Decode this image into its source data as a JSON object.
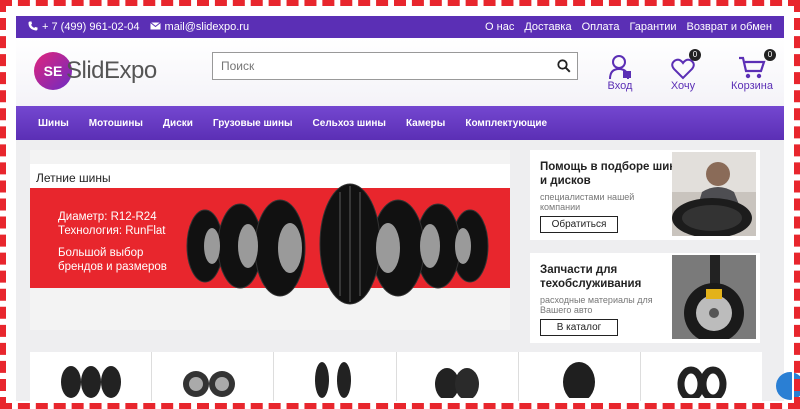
{
  "topbar": {
    "phone": "+ 7 (499) 961-02-04",
    "email": "mail@slidexpo.ru",
    "links": [
      "О нас",
      "Доставка",
      "Оплата",
      "Гарантии",
      "Возврат и обмен"
    ]
  },
  "header": {
    "logo_mark": "SE",
    "logo_text": "SlidExpo",
    "search_placeholder": "Поиск",
    "login_label": "Вход",
    "wishlist_label": "Хочу",
    "wishlist_count": "0",
    "cart_label": "Корзина",
    "cart_count": "0"
  },
  "nav": {
    "items": [
      "Шины",
      "Мотошины",
      "Диски",
      "Грузовые шины",
      "Сельхоз шины",
      "Камеры",
      "Комплектующие"
    ]
  },
  "banner": {
    "title": "Летние шины",
    "line1": "Диаметр: R12-R24",
    "line2": "Технология: RunFlat",
    "line3": "Большой выбор",
    "line4": "брендов и размеров"
  },
  "promo1": {
    "title": "Помощь в подборе шин и дисков",
    "subtitle": "специалистами нашей компании",
    "button": "Обратиться"
  },
  "promo2": {
    "title": "Запчасти для техобслуживания",
    "subtitle": "расходные материалы для Вашего авто",
    "button": "В каталог"
  },
  "colors": {
    "brand_purple": "#5b2fb5",
    "banner_red": "#e8262d",
    "frame_red": "#e8262d"
  },
  "icons": {
    "phone": "phone-icon",
    "email": "mail-icon",
    "search": "search-icon",
    "login": "user-icon",
    "wishlist": "heart-icon",
    "cart": "cart-icon"
  }
}
